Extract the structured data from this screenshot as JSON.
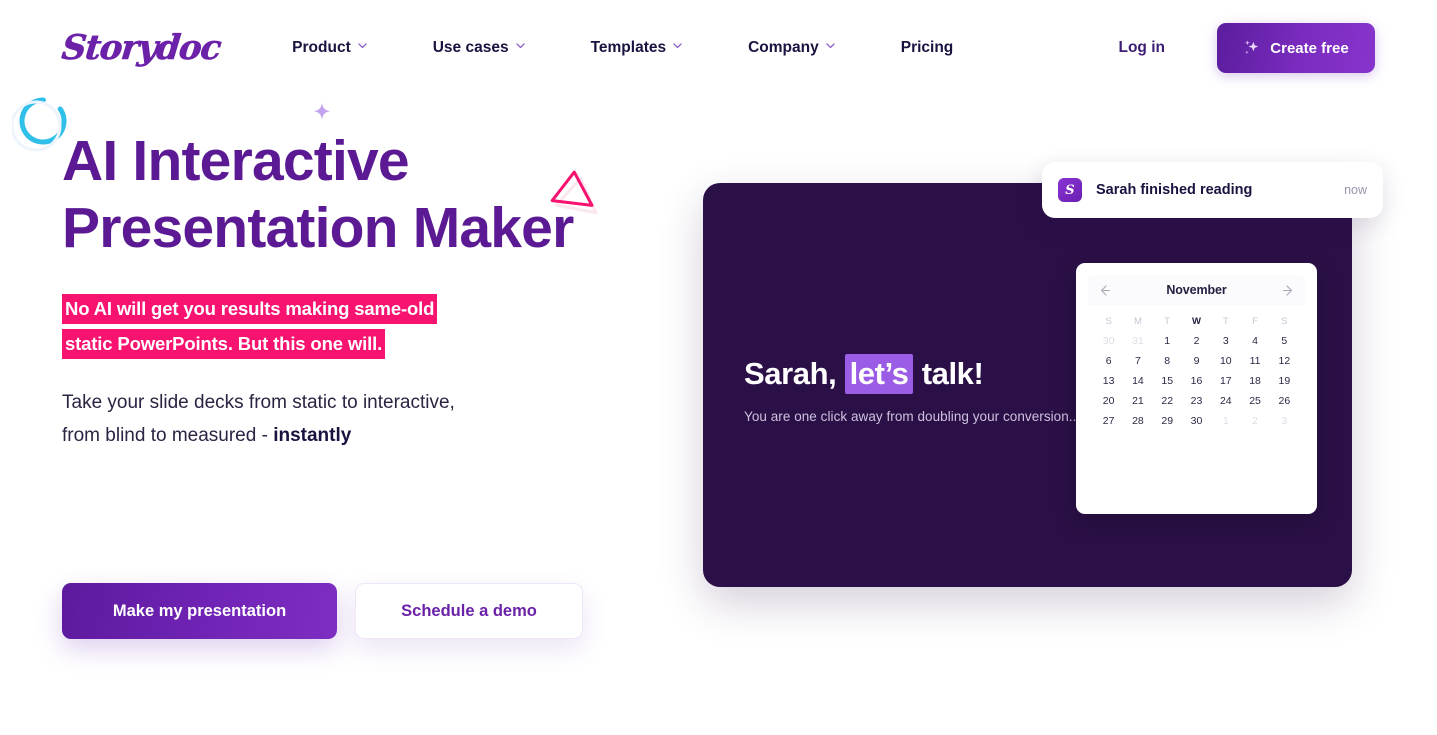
{
  "brand": {
    "logo_text": "Storydoc",
    "accent_purple": "#5b1a94",
    "accent_pink": "#f7136f",
    "slide_dark": "#2b1047",
    "highlight_purple": "#9b5de5"
  },
  "nav": {
    "items": [
      {
        "label": "Product",
        "has_dropdown": true
      },
      {
        "label": "Use cases",
        "has_dropdown": true
      },
      {
        "label": "Templates",
        "has_dropdown": true
      },
      {
        "label": "Company",
        "has_dropdown": true
      },
      {
        "label": "Pricing",
        "has_dropdown": false
      }
    ],
    "login_label": "Log in",
    "create_label": "Create free",
    "create_icon": "sparkle-icon"
  },
  "hero": {
    "headline": "AI Interactive Presentation Maker",
    "highlight_line_1": "No AI will get you results making same-old",
    "highlight_line_2": "static PowerPoints. But this one will.",
    "subcopy_line_1": "Take your slide decks from static to interactive,",
    "subcopy_line_2_prefix": "from blind to measured - ",
    "subcopy_line_2_bold": "instantly",
    "cta_primary": "Make my presentation",
    "cta_secondary": "Schedule a demo"
  },
  "decor": {
    "arc": "circle-arc-decoration",
    "sparkle": "sparkle-decoration",
    "triangle": "triangle-decoration"
  },
  "slide": {
    "title_prefix": "Sarah,",
    "title_highlight": "let’s",
    "title_suffix": "talk!",
    "subtitle": "You are one click away from doubling your conversion..."
  },
  "calendar": {
    "month": "November",
    "prev_icon": "arrow-left-icon",
    "next_icon": "arrow-right-icon",
    "day_names": [
      "S",
      "M",
      "T",
      "W",
      "T",
      "F",
      "S"
    ],
    "active_day_name_index": 3,
    "weeks": [
      [
        {
          "n": "30",
          "muted": true
        },
        {
          "n": "31",
          "muted": true
        },
        {
          "n": "1",
          "muted": false
        },
        {
          "n": "2",
          "muted": false
        },
        {
          "n": "3",
          "muted": false
        },
        {
          "n": "4",
          "muted": false
        },
        {
          "n": "5",
          "muted": false
        }
      ],
      [
        {
          "n": "6",
          "muted": false
        },
        {
          "n": "7",
          "muted": false
        },
        {
          "n": "8",
          "muted": false
        },
        {
          "n": "9",
          "muted": false
        },
        {
          "n": "10",
          "muted": false
        },
        {
          "n": "11",
          "muted": false
        },
        {
          "n": "12",
          "muted": false
        }
      ],
      [
        {
          "n": "13",
          "muted": false
        },
        {
          "n": "14",
          "muted": false
        },
        {
          "n": "15",
          "muted": false
        },
        {
          "n": "16",
          "muted": false
        },
        {
          "n": "17",
          "muted": false
        },
        {
          "n": "18",
          "muted": false
        },
        {
          "n": "19",
          "muted": false
        }
      ],
      [
        {
          "n": "20",
          "muted": false
        },
        {
          "n": "21",
          "muted": false
        },
        {
          "n": "22",
          "muted": false
        },
        {
          "n": "23",
          "muted": false
        },
        {
          "n": "24",
          "muted": false
        },
        {
          "n": "25",
          "muted": false
        },
        {
          "n": "26",
          "muted": false
        }
      ],
      [
        {
          "n": "27",
          "muted": false
        },
        {
          "n": "28",
          "muted": false
        },
        {
          "n": "29",
          "muted": false
        },
        {
          "n": "30",
          "muted": false
        },
        {
          "n": "1",
          "muted": true
        },
        {
          "n": "2",
          "muted": true
        },
        {
          "n": "3",
          "muted": true
        }
      ]
    ]
  },
  "toast": {
    "app_initial": "S",
    "message": "Sarah finished reading",
    "time": "now"
  }
}
